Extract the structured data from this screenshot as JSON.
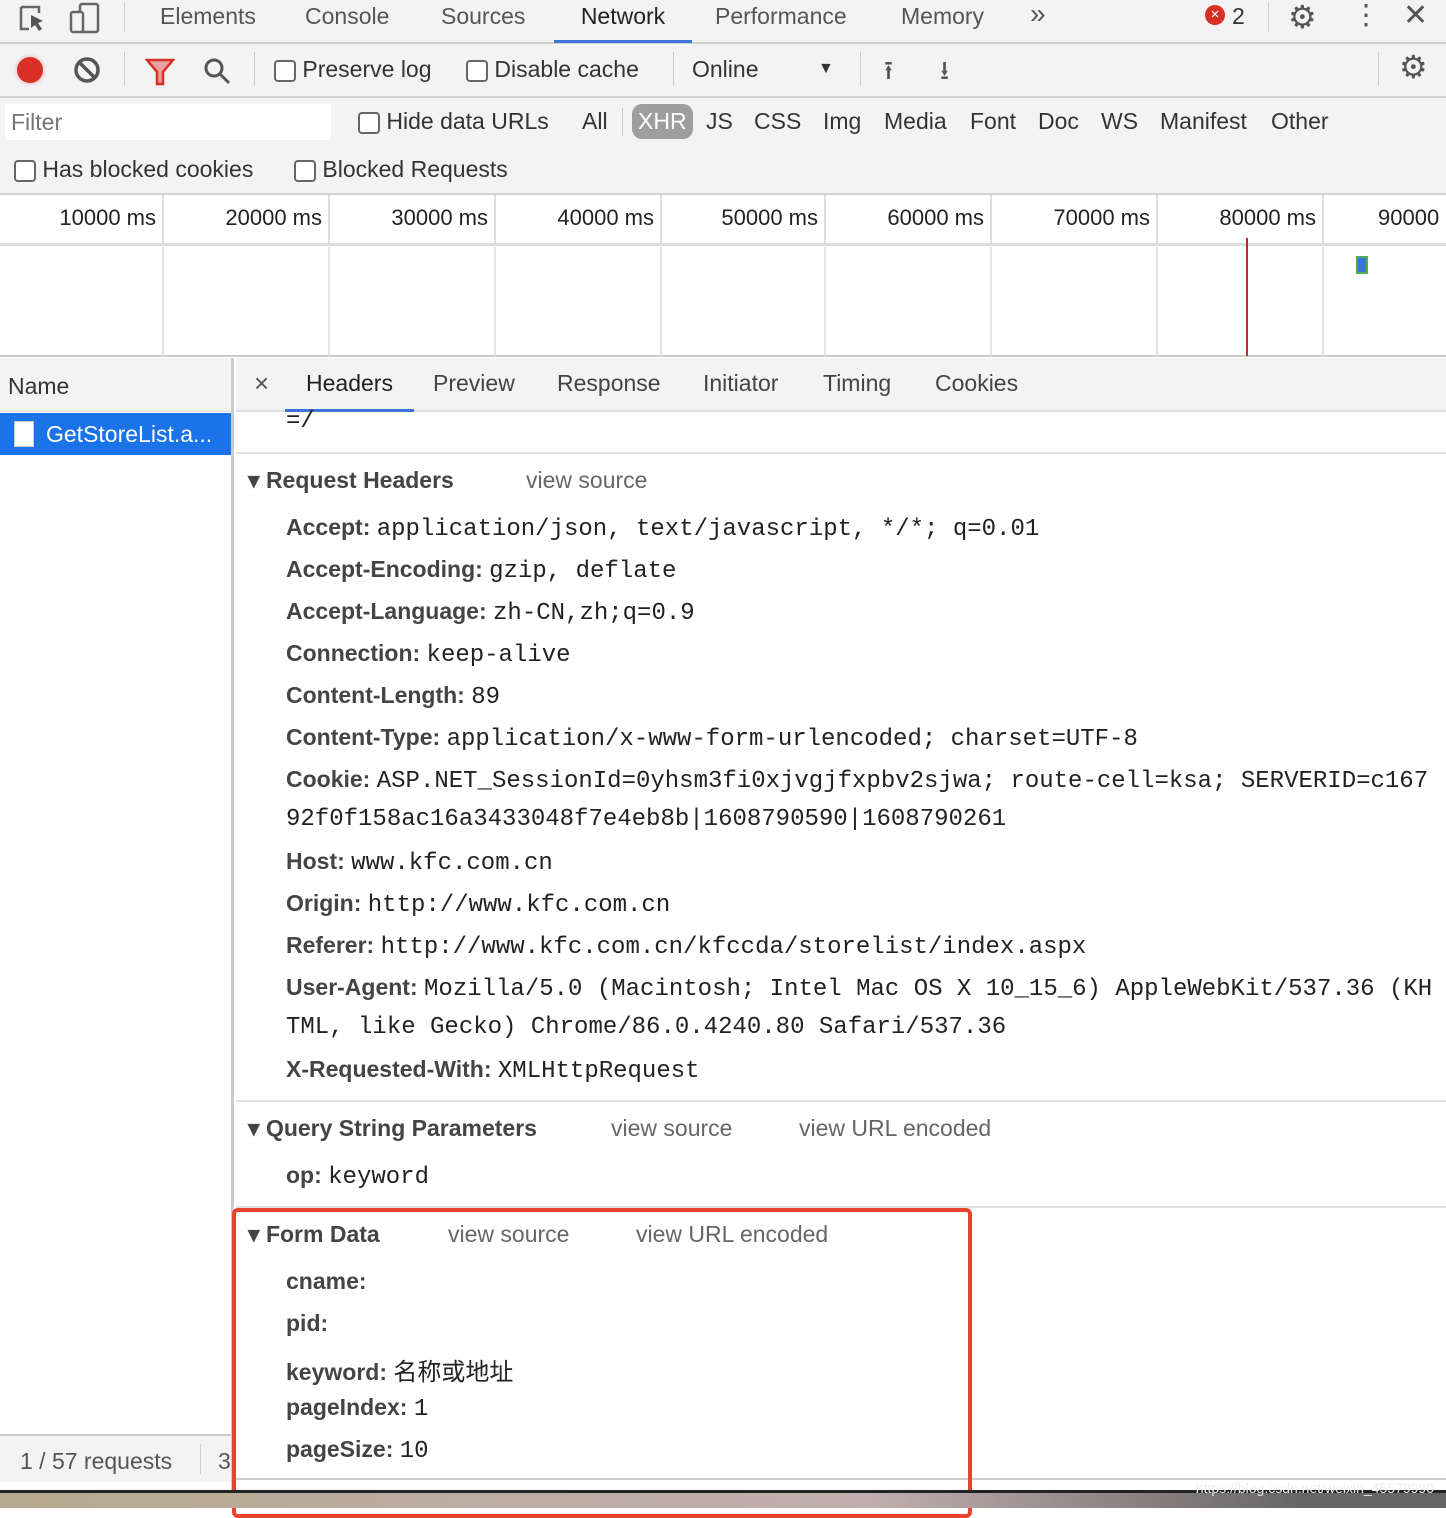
{
  "top_tabs": [
    "Elements",
    "Console",
    "Sources",
    "Network",
    "Performance",
    "Memory"
  ],
  "more_tabs": "»",
  "error_count": "2",
  "toolbar": {
    "preserve_log": "Preserve log",
    "disable_cache": "Disable cache",
    "throttling": "Online"
  },
  "filter": {
    "placeholder": "Filter",
    "hide_data_urls": "Hide data URLs",
    "types": [
      "All",
      "XHR",
      "JS",
      "CSS",
      "Img",
      "Media",
      "Font",
      "Doc",
      "WS",
      "Manifest",
      "Other"
    ],
    "active_type": "XHR",
    "has_blocked_cookies": "Has blocked cookies",
    "blocked_requests": "Blocked Requests"
  },
  "timeline": {
    "ticks": [
      "10000 ms",
      "20000 ms",
      "30000 ms",
      "40000 ms",
      "50000 ms",
      "60000 ms",
      "70000 ms",
      "80000 ms",
      "90000"
    ]
  },
  "list": {
    "header": "Name",
    "items": [
      "GetStoreList.a..."
    ],
    "footer": "1 / 57 requests",
    "footer_extra": "3"
  },
  "detail": {
    "close": "×",
    "tabs": [
      "Headers",
      "Preview",
      "Response",
      "Initiator",
      "Timing",
      "Cookies"
    ],
    "active_tab": "Headers",
    "cut_line": "=/",
    "request_headers": {
      "title": "Request Headers",
      "view_source": "view source",
      "rows": [
        {
          "k": "Accept:",
          "v": "application/json, text/javascript, */*; q=0.01"
        },
        {
          "k": "Accept-Encoding:",
          "v": "gzip, deflate"
        },
        {
          "k": "Accept-Language:",
          "v": "zh-CN,zh;q=0.9"
        },
        {
          "k": "Connection:",
          "v": "keep-alive"
        },
        {
          "k": "Content-Length:",
          "v": "89"
        },
        {
          "k": "Content-Type:",
          "v": "application/x-www-form-urlencoded; charset=UTF-8"
        },
        {
          "k": "Cookie:",
          "v": "ASP.NET_SessionId=0yhsm3fi0xjvgjfxpbv2sjwa; route-cell=ksa; SERVERID=c167",
          "cont": "92f0f158ac16a3433048f7e4eb8b|1608790590|1608790261"
        },
        {
          "k": "Host:",
          "v": "www.kfc.com.cn"
        },
        {
          "k": "Origin:",
          "v": "http://www.kfc.com.cn"
        },
        {
          "k": "Referer:",
          "v": "http://www.kfc.com.cn/kfccda/storelist/index.aspx"
        },
        {
          "k": "User-Agent:",
          "v": "Mozilla/5.0 (Macintosh; Intel Mac OS X 10_15_6) AppleWebKit/537.36 (KH",
          "cont": "TML, like Gecko) Chrome/86.0.4240.80 Safari/537.36"
        },
        {
          "k": "X-Requested-With:",
          "v": "XMLHttpRequest"
        }
      ]
    },
    "query": {
      "title": "Query String Parameters",
      "view_source": "view source",
      "view_url": "view URL encoded",
      "rows": [
        {
          "k": "op:",
          "v": "keyword"
        }
      ]
    },
    "form": {
      "title": "Form Data",
      "view_source": "view source",
      "view_url": "view URL encoded",
      "rows": [
        {
          "k": "cname:",
          "v": ""
        },
        {
          "k": "pid:",
          "v": ""
        },
        {
          "k": "keyword:",
          "v": "名称或地址"
        },
        {
          "k": "pageIndex:",
          "v": "1"
        },
        {
          "k": "pageSize:",
          "v": "10"
        }
      ]
    }
  },
  "watermark": "https://blog.csdn.net/weixin_45579990",
  "colors": {
    "accent": "#3a76d8",
    "record": "#d93025",
    "highlight_box": "#e8432f",
    "selected_row": "#1a73e8"
  }
}
